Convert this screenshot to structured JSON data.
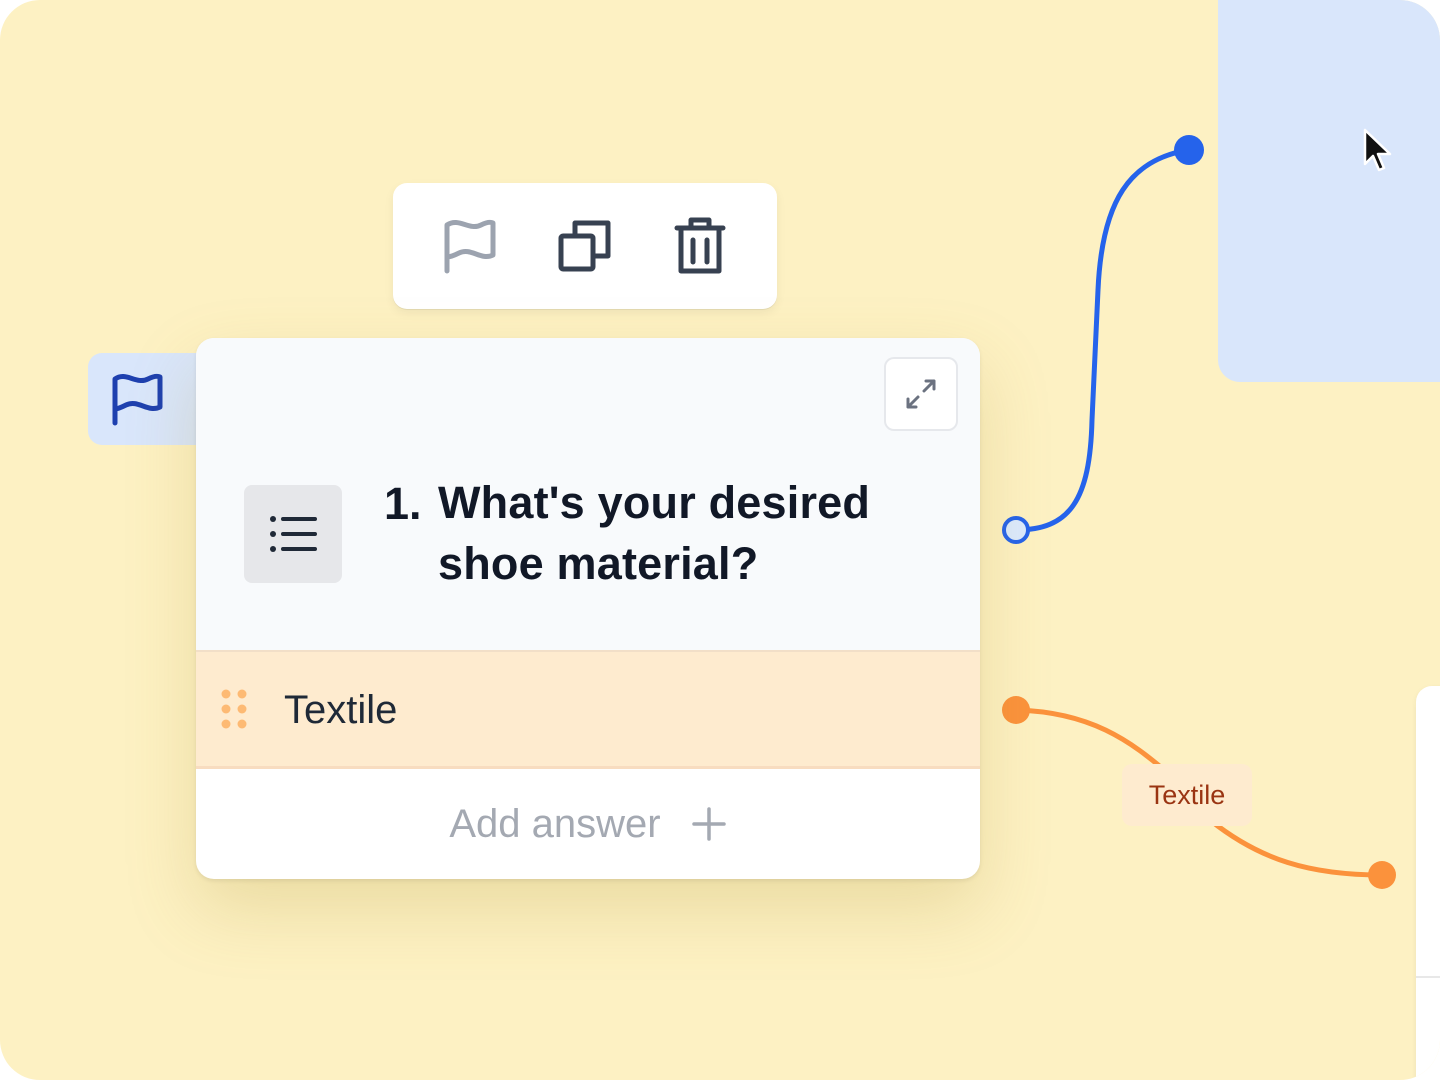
{
  "toolbar": {
    "flag_icon": "flag-outline-icon",
    "duplicate_icon": "duplicate-icon",
    "delete_icon": "trash-icon"
  },
  "question_card": {
    "number": "1.",
    "title": "What's your desired shoe material?",
    "type_icon": "list-icon",
    "expand_icon": "expand-arrows-icon",
    "answers": [
      {
        "label": "Textile"
      }
    ],
    "add_answer_label": "Add answer"
  },
  "edge": {
    "label": "Textile"
  },
  "colors": {
    "canvas": "#fdf1c3",
    "blue_connector": "#2563eb",
    "orange_connector": "#fb923c",
    "blue_node": "#d9e6fb",
    "answer_highlight": "#feebcf",
    "edge_label_text": "#9a3412"
  }
}
